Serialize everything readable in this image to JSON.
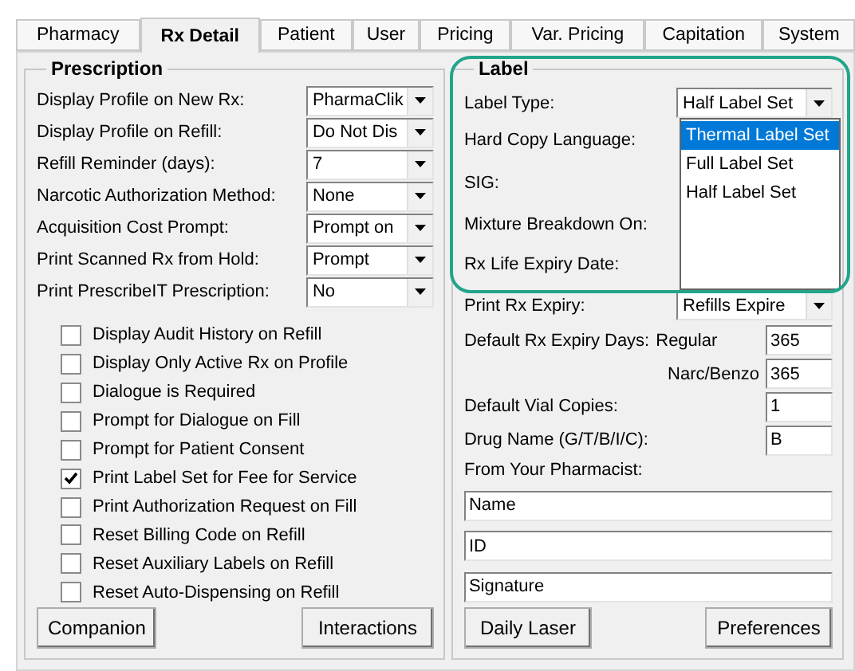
{
  "tabs": [
    {
      "label": "Pharmacy",
      "selected": false
    },
    {
      "label": "Rx Detail",
      "selected": true
    },
    {
      "label": "Patient",
      "selected": false
    },
    {
      "label": "User",
      "selected": false
    },
    {
      "label": "Pricing",
      "selected": false
    },
    {
      "label": "Var. Pricing",
      "selected": false
    },
    {
      "label": "Capitation",
      "selected": false
    },
    {
      "label": "System",
      "selected": false
    }
  ],
  "prescription": {
    "title": "Prescription",
    "settings": [
      {
        "label": "Display Profile on New Rx:",
        "value": "PharmaClik"
      },
      {
        "label": "Display Profile on Refill:",
        "value": "Do Not Dis"
      },
      {
        "label": "Refill Reminder (days):",
        "value": "7"
      },
      {
        "label": "Narcotic Authorization Method:",
        "value": "None"
      },
      {
        "label": "Acquisition Cost Prompt:",
        "value": "Prompt on"
      },
      {
        "label": "Print Scanned Rx from Hold:",
        "value": "Prompt"
      },
      {
        "label": "Print PrescribeIT Prescription:",
        "value": "No"
      }
    ],
    "options": [
      {
        "label": "Display Audit History on Refill",
        "checked": false
      },
      {
        "label": "Display Only Active Rx on Profile",
        "checked": false
      },
      {
        "label": "Dialogue is Required",
        "checked": false
      },
      {
        "label": "Prompt for Dialogue on Fill",
        "checked": false
      },
      {
        "label": "Prompt for Patient Consent",
        "checked": false
      },
      {
        "label": "Print Label Set for Fee for Service",
        "checked": true
      },
      {
        "label": "Print Authorization Request on Fill",
        "checked": false
      },
      {
        "label": "Reset Billing Code on Refill",
        "checked": false
      },
      {
        "label": "Reset Auxiliary Labels on Refill",
        "checked": false
      },
      {
        "label": "Reset Auto-Dispensing on Refill",
        "checked": false
      }
    ],
    "buttons": [
      "Companion",
      "Interactions"
    ]
  },
  "label": {
    "title": "Label",
    "label_type": {
      "label": "Label Type:",
      "value": "Half Label Set",
      "expanded": true,
      "options": [
        {
          "label": "Thermal Label Set",
          "highlighted": true
        },
        {
          "label": "Full Label Set",
          "highlighted": false
        },
        {
          "label": "Half Label Set",
          "highlighted": false
        }
      ]
    },
    "hidden_rows": [
      "Hard Copy Language:",
      "SIG:",
      "Mixture Breakdown On:",
      "Rx Life Expiry Date:"
    ],
    "print_rx_expiry": {
      "label": "Print Rx Expiry:",
      "value": "Refills Expire"
    },
    "expiry_days": {
      "label": "Default Rx Expiry Days:",
      "regular_label": "Regular",
      "regular_value": "365",
      "narc_label": "Narc/Benzo",
      "narc_value": "365"
    },
    "vial_copies": {
      "label": "Default Vial Copies:",
      "value": "1"
    },
    "drug_name": {
      "label": "Drug Name (G/T/B/I/C):",
      "value": "B"
    },
    "pharmacist": {
      "label": "From Your Pharmacist:",
      "fields": [
        "Name",
        "ID",
        "Signature"
      ]
    },
    "buttons": [
      "Daily Laser",
      "Preferences"
    ]
  }
}
